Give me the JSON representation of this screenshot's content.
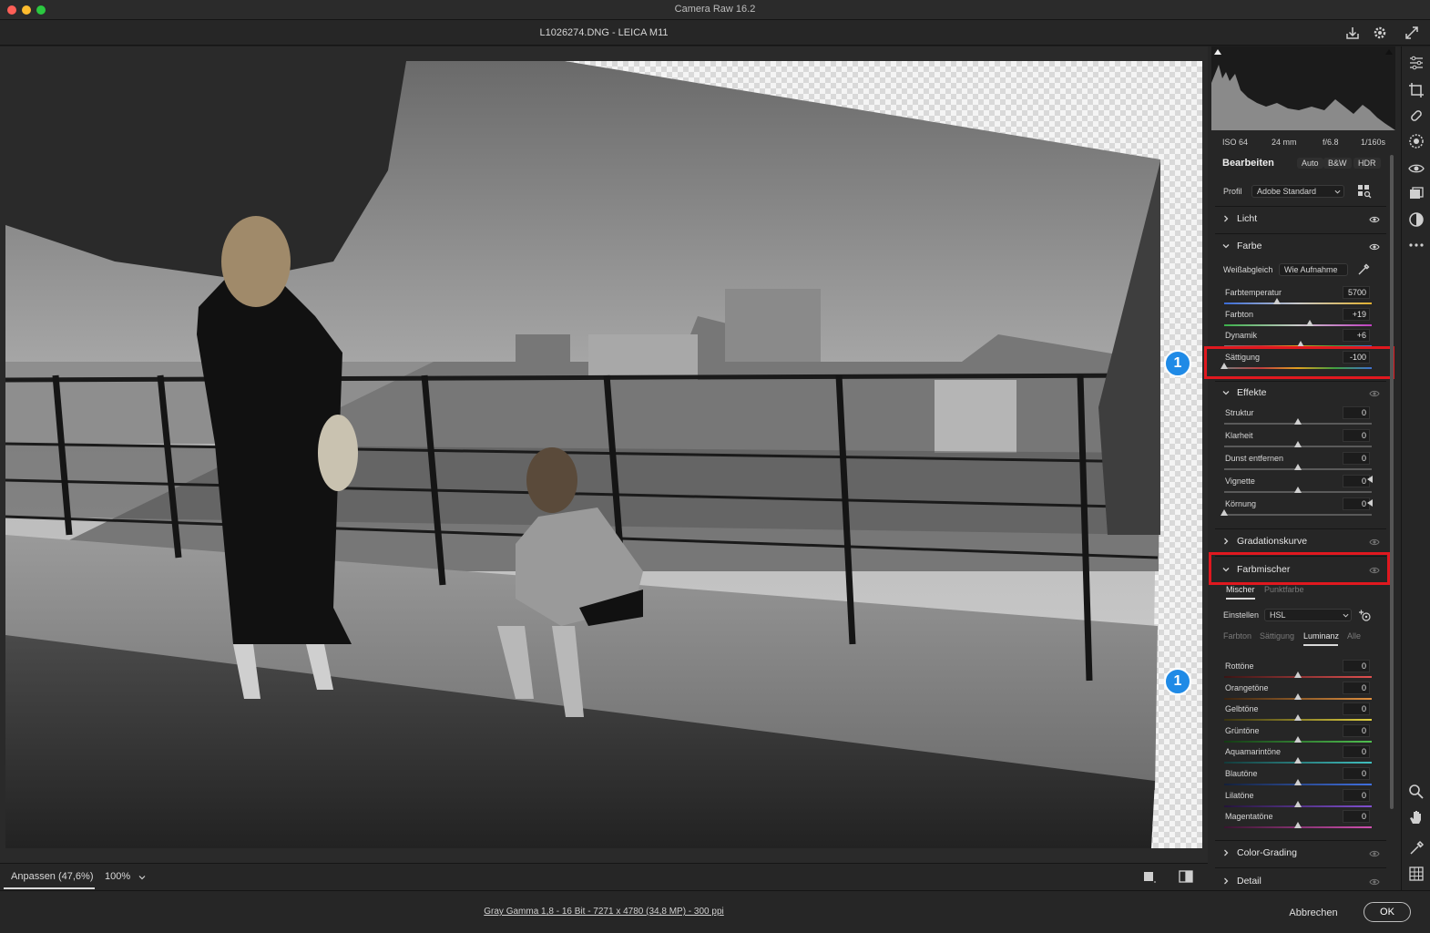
{
  "window": {
    "title": "Camera Raw 16.2",
    "file_title": "L1026274.DNG - LEICA M11"
  },
  "colors": {
    "accent": "#1f8ae6",
    "highlight_box": "#e0181f",
    "close": "#fe5f57",
    "minimize": "#febc2e",
    "zoom": "#2bc840"
  },
  "badges": [
    "1",
    "1"
  ],
  "exif": {
    "iso": "ISO 64",
    "focal": "24 mm",
    "aperture": "f/6.8",
    "shutter": "1/160s"
  },
  "edit": {
    "title": "Bearbeiten",
    "buttons": [
      "Auto",
      "B&W",
      "HDR"
    ],
    "profile_label": "Profil",
    "profile_value": "Adobe Standard"
  },
  "sections": {
    "licht": "Licht",
    "farbe": "Farbe",
    "effekte": "Effekte",
    "gradationskurve": "Gradationskurve",
    "farbmischer": "Farbmischer",
    "color_grading": "Color-Grading",
    "detail": "Detail"
  },
  "farbe": {
    "wb_label": "Weißabgleich",
    "wb_value": "Wie Aufnahme",
    "sliders": [
      {
        "label": "Farbtemperatur",
        "value": "5700",
        "pos": 0.36
      },
      {
        "label": "Farbton",
        "value": "+19",
        "pos": 0.58
      },
      {
        "label": "Dynamik",
        "value": "+6",
        "pos": 0.52
      },
      {
        "label": "Sättigung",
        "value": "-100",
        "pos": 0.0
      }
    ]
  },
  "effekte": {
    "sliders": [
      {
        "label": "Struktur",
        "value": "0",
        "pos": 0.5
      },
      {
        "label": "Klarheit",
        "value": "0",
        "pos": 0.5
      },
      {
        "label": "Dunst entfernen",
        "value": "0",
        "pos": 0.5
      },
      {
        "label": "Vignette",
        "value": "0",
        "pos": 0.5
      },
      {
        "label": "Körnung",
        "value": "0",
        "pos": 0.0
      }
    ]
  },
  "farbmischer": {
    "tabs": [
      "Mischer",
      "Punktfarbe"
    ],
    "einstellen_label": "Einstellen",
    "einstellen_value": "HSL",
    "subtabs": [
      "Farbton",
      "Sättigung",
      "Luminanz",
      "Alle"
    ],
    "sliders": [
      {
        "label": "Rottöne",
        "value": "0",
        "pos": 0.5
      },
      {
        "label": "Orangetöne",
        "value": "0",
        "pos": 0.5
      },
      {
        "label": "Gelbtöne",
        "value": "0",
        "pos": 0.5
      },
      {
        "label": "Grüntöne",
        "value": "0",
        "pos": 0.5
      },
      {
        "label": "Aquamarintöne",
        "value": "0",
        "pos": 0.5
      },
      {
        "label": "Blautöne",
        "value": "0",
        "pos": 0.5
      },
      {
        "label": "Lilatöne",
        "value": "0",
        "pos": 0.5
      },
      {
        "label": "Magentatöne",
        "value": "0",
        "pos": 0.5
      }
    ]
  },
  "bottom": {
    "zoom_fit": "Anpassen (47,6%)",
    "zoom_100": "100%"
  },
  "footer": {
    "info": "Gray Gamma 1,8 - 16 Bit - 7271 x 4780 (34,8 MP) - 300 ppi",
    "cancel": "Abbrechen",
    "ok": "OK"
  }
}
